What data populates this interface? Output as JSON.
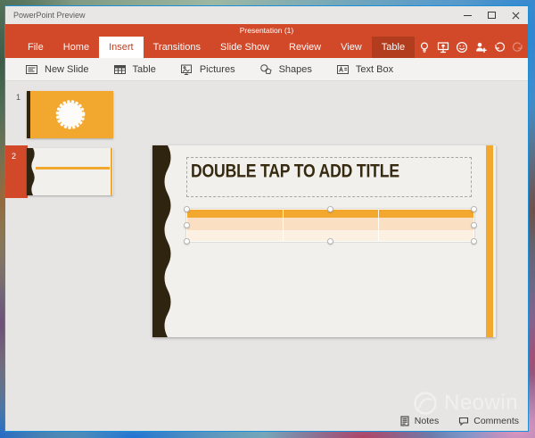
{
  "window": {
    "title": "PowerPoint Preview"
  },
  "presentation_bar": {
    "title": "Presentation (1)"
  },
  "ribbon": {
    "tabs": [
      {
        "label": "File",
        "state": "normal"
      },
      {
        "label": "Home",
        "state": "normal"
      },
      {
        "label": "Insert",
        "state": "active"
      },
      {
        "label": "Transitions",
        "state": "normal"
      },
      {
        "label": "Slide Show",
        "state": "normal"
      },
      {
        "label": "Review",
        "state": "normal"
      },
      {
        "label": "View",
        "state": "normal"
      },
      {
        "label": "Table",
        "state": "contextual"
      }
    ],
    "icons": [
      "lightbulb-icon",
      "present-screen-icon",
      "feedback-smiley-icon",
      "share-person-icon",
      "undo-icon",
      "redo-icon"
    ],
    "undo_enabled": true,
    "redo_enabled": false
  },
  "toolbar": {
    "buttons": [
      {
        "label": "New Slide",
        "icon": "new-slide-icon"
      },
      {
        "label": "Table",
        "icon": "insert-table-icon"
      },
      {
        "label": "Pictures",
        "icon": "pictures-icon"
      },
      {
        "label": "Shapes",
        "icon": "shapes-icon"
      },
      {
        "label": "Text Box",
        "icon": "text-box-icon"
      }
    ]
  },
  "thumbnail_panel": {
    "slides": [
      {
        "number": "1",
        "selected": false
      },
      {
        "number": "2",
        "selected": true
      }
    ]
  },
  "slide": {
    "title_placeholder_text": "DOUBLE TAP TO ADD TITLE",
    "table": {
      "rows": 3,
      "columns": 3,
      "selected": true,
      "header_color": "#f2a72e",
      "row2_color": "#fbdfc2",
      "row3_color": "#fcf0e3"
    }
  },
  "statusbar": {
    "notes_label": "Notes",
    "comments_label": "Comments"
  },
  "watermark": {
    "text": "Neowin"
  },
  "colors": {
    "ribbon_red": "#d2492a",
    "contextual_tab_red": "#b23c1e",
    "accent_orange": "#f2a72e",
    "dark_brown": "#2e2410",
    "window_border_blue": "#1e8fd5"
  }
}
